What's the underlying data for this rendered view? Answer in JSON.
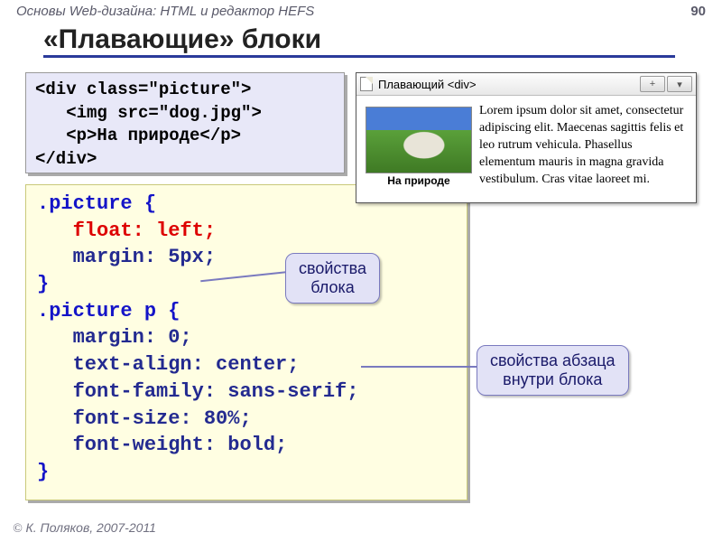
{
  "header": {
    "breadcrumb": "Основы Web-дизайна: HTML и редактор HEFS",
    "page": "90"
  },
  "title": "«Плавающие» блоки",
  "html_code": "<div class=\"picture\">\n   <img src=\"dog.jpg\">\n   <p>На природе</p>\n</div>",
  "css_code": {
    "l1": ".picture {",
    "l2": "float: left;",
    "l3": "margin: 5px;",
    "l4": "}",
    "l5": ".picture p {",
    "l6": "margin: 0;",
    "l7": "text-align: center;",
    "l8": "font-family: sans-serif;",
    "l9": "font-size: 80%;",
    "l10": "font-weight: bold;",
    "l11": "}"
  },
  "browser": {
    "title": "Плавающий <div>",
    "caption": "На природе",
    "lorem": "Lorem ipsum dolor sit amet, consectetur adipiscing elit. Maecenas sagittis felis et leo rutrum vehicula. Phasellus elementum mauris in magna gravida vestibulum. Cras vitae laoreet mi."
  },
  "callouts": {
    "block": "свойства\nблока",
    "para": "свойства абзаца\nвнутри блока"
  },
  "footer": "К. Поляков, 2007-2011"
}
